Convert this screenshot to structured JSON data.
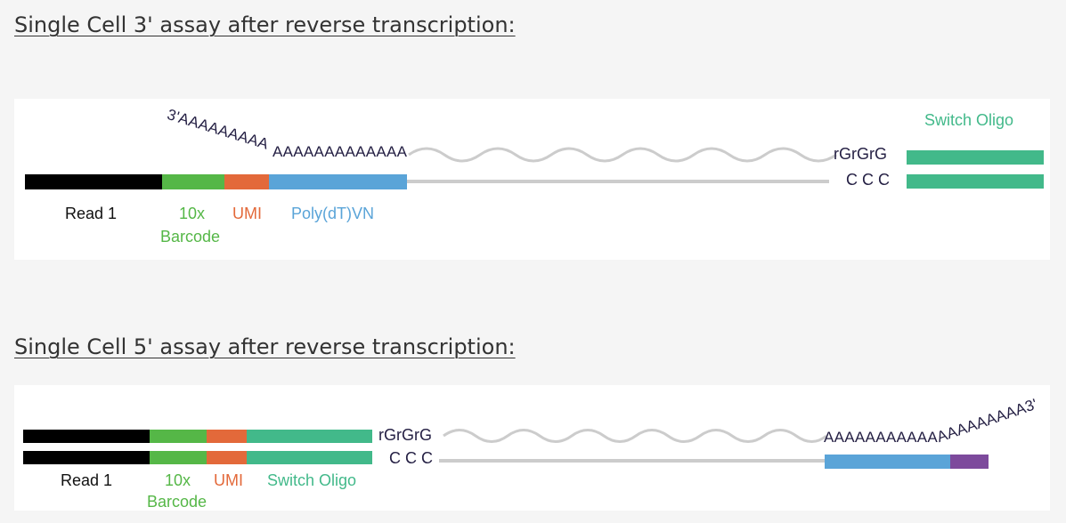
{
  "headings": {
    "top": "Single Cell 3' assay after reverse transcription:",
    "bottom": "Single Cell 5' assay after reverse transcription:"
  },
  "colors": {
    "read1": "#000000",
    "barcode": "#55b747",
    "umi": "#e3693a",
    "polydt": "#5aa4d8",
    "switch_oligo": "#42b98a",
    "cdna_line": "#cccccc",
    "extra": "#7d4a9c",
    "polya_text": "#252044"
  },
  "assay_3prime": {
    "labels": {
      "read1": "Read 1",
      "barcode_a": "10x",
      "barcode_b": "Barcode",
      "umi": "UMI",
      "polydt": "Poly(dT)VN",
      "rgrgrg": "rGrGrG",
      "ccc": "C C C",
      "switch_oligo": "Switch Oligo"
    },
    "polya_a": "3'AAAAAAAAA",
    "polya_b": "AAAAAAAAAAAAA"
  },
  "assay_5prime": {
    "labels": {
      "read1": "Read 1",
      "barcode_a": "10x",
      "barcode_b": "Barcode",
      "umi": "UMI",
      "switch_oligo": "Switch Oligo",
      "rgrgrg": "rGrGrG",
      "ccc": "C C C"
    },
    "polya_a": "AAAAAAAAAAA",
    "polya_b": "AAAAAAAAA3'"
  }
}
